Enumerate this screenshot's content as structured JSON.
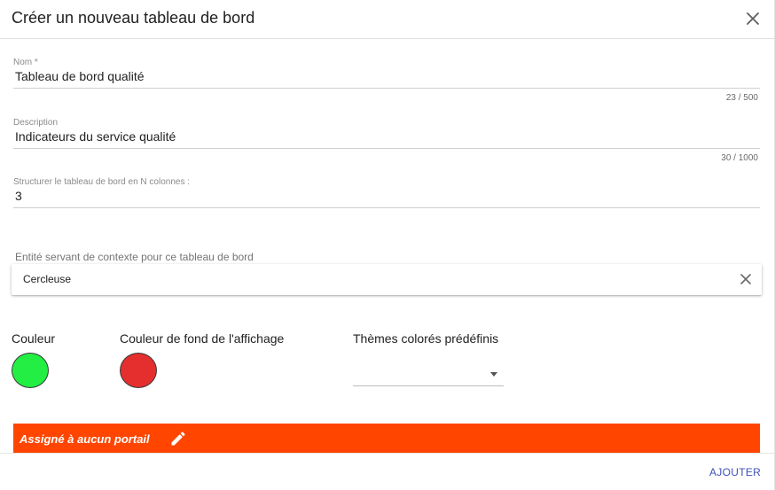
{
  "dialog": {
    "title": "Créer un nouveau tableau de bord"
  },
  "fields": {
    "name": {
      "label": "Nom *",
      "value": "Tableau de bord qualité",
      "counter": "23 / 500"
    },
    "description": {
      "label": "Description",
      "value": "Indicateurs du service qualité",
      "counter": "30 / 1000"
    },
    "columns": {
      "label": "Structurer le tableau de bord en N colonnes :",
      "value": "3"
    }
  },
  "entity": {
    "label": "Entité servant de contexte pour ce tableau de bord",
    "value": "Cercleuse"
  },
  "colors": {
    "color_label": "Couleur",
    "color_value": "#22ee44",
    "background_label": "Couleur de fond de l'affichage",
    "background_value": "#e52e2e",
    "themes_label": "Thèmes colorés prédéfinis",
    "themes_value": ""
  },
  "portal": {
    "text": "Assigné à aucun portail",
    "banner_color": "#ff4500"
  },
  "footer": {
    "add_label": "AJOUTER"
  },
  "icons": {
    "close": "close-icon",
    "clear": "clear-icon",
    "edit": "pencil-icon",
    "dropdown": "dropdown-arrow-icon"
  }
}
